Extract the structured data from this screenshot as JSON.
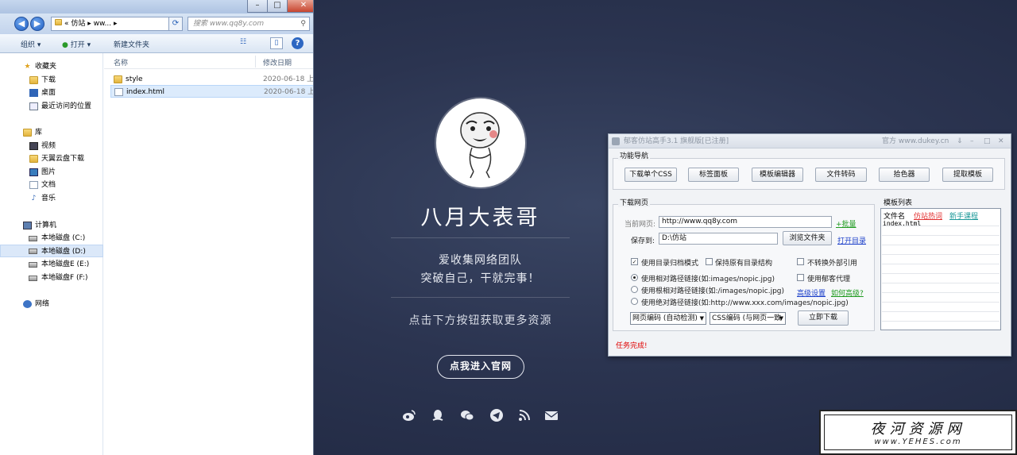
{
  "explorer": {
    "address": "« 仿站 ▸ ww... ▸",
    "search_placeholder": "搜索 www.qq8y.com",
    "toolbar": {
      "organize": "组织 ▾",
      "open": "打开 ▾",
      "new_folder": "新建文件夹"
    },
    "columns": {
      "name": "名称",
      "modified": "修改日期"
    },
    "nav": {
      "favorites": "收藏夹",
      "downloads": "下载",
      "desktop": "桌面",
      "recent": "最近访问的位置",
      "libraries": "库",
      "videos": "视频",
      "tianyi": "天翼云盘下载",
      "pictures": "图片",
      "documents": "文档",
      "music": "音乐",
      "computer": "计算机",
      "disk_c": "本地磁盘 (C:)",
      "disk_d": "本地磁盘 (D:)",
      "disk_e": "本地磁盘E (E:)",
      "disk_f": "本地磁盘F (F:)",
      "network": "网络"
    },
    "files": [
      {
        "name": "style",
        "date": "2020-06-18 上",
        "type": "folder"
      },
      {
        "name": "index.html",
        "date": "2020-06-18 上",
        "type": "file"
      }
    ]
  },
  "profile": {
    "name": "八月大表哥",
    "tagline1": "爱收集网络团队",
    "tagline2": "突破自己，干就完事！",
    "cta": "点击下方按钮获取更多资源",
    "enter_button": "点我进入官网",
    "social_icons": [
      "weibo-icon",
      "qq-icon",
      "wechat-icon",
      "telegram-icon",
      "rss-icon",
      "mail-icon"
    ]
  },
  "tool": {
    "title": "郁客仿站高手3.1 旗舰版[已注册]",
    "official": "官方 www.dukey.cn",
    "func_nav_label": "功能导航",
    "buttons": [
      "下载单个CSS",
      "标签面板",
      "模板编辑器",
      "文件转码",
      "拾色器",
      "提取模板"
    ],
    "download_group_label": "下载网页",
    "current_page_label": "当前网页:",
    "current_page_value": "http://www.qq8y.com",
    "batch_link": "+批量",
    "save_to_label": "保存到:",
    "save_to_value": "D:\\仿站",
    "browse_button": "浏览文件夹",
    "open_dir_link": "打开目录",
    "opt_dir_mode": "使用目录归档模式",
    "opt_keep_structure": "保持原有目录结构",
    "opt_no_external": "不转换外部引用",
    "opt_use_proxy": "使用郁客代理",
    "radio_relative": "使用相对路径链接(如:images/nopic.jpg)",
    "radio_root": "使用根相对路径链接(如:/images/nopic.jpg)",
    "radio_absolute": "使用绝对路径链接(如:http://www.xxx.com/images/nopic.jpg)",
    "advanced_link": "高级设置",
    "how_advanced_link": "如何高级?",
    "encoding_select": "网页编码 (自动检测)",
    "css_encoding_select": "CSS编码 (与网页一致",
    "download_now_button": "立即下载",
    "template_list_label": "模板列表",
    "list_headers": {
      "filename": "文件名",
      "hot": "仿站热词",
      "tutorial": "新手课程"
    },
    "list_items": [
      "index.html"
    ],
    "status": "任务完成!"
  },
  "watermark": {
    "cn": "夜河资源网",
    "url": "www.YEHES.com"
  }
}
